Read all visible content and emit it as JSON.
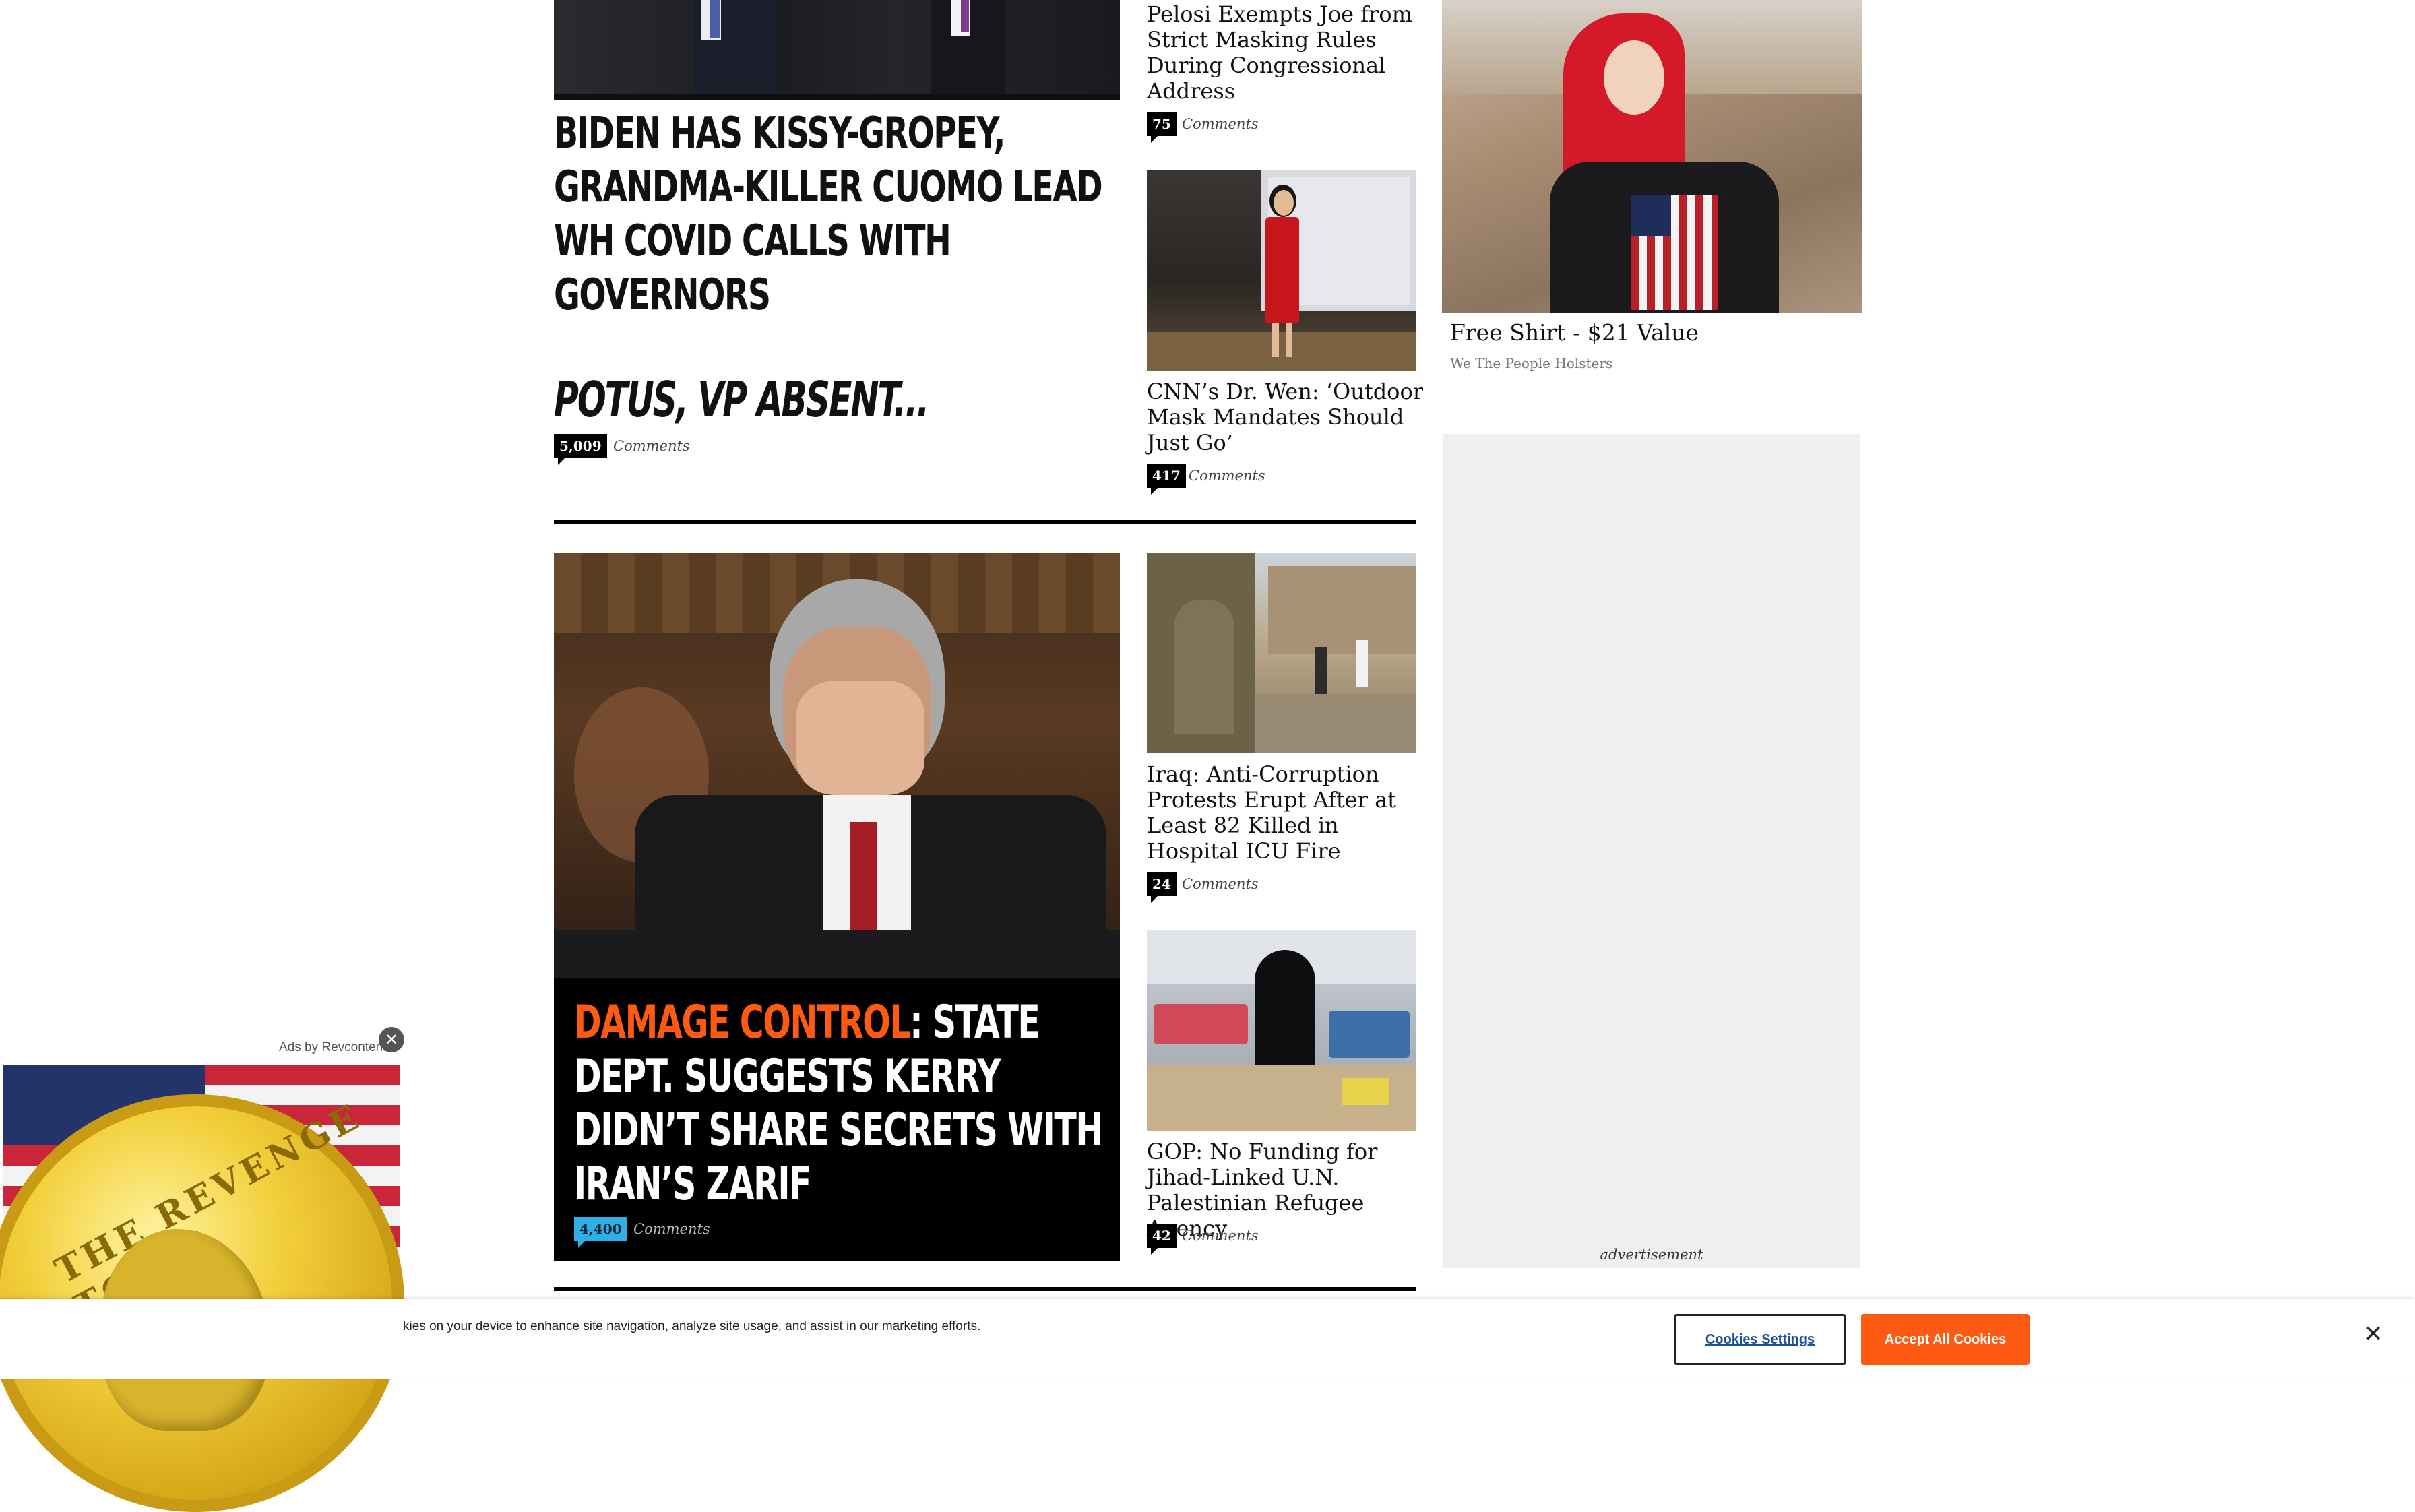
{
  "top_story": {
    "headline": "BIDEN HAS KISSY-GROPEY, GRANDMA-KILLER CUOMO LEAD WH COVID CALLS WITH GOVERNORS",
    "subhead": "POTUS, VP ABSENT...",
    "comment_count": "5,009",
    "comments_label": "Comments"
  },
  "side_stories_top": [
    {
      "title": "Pelosi Exempts Joe from Strict Masking Rules During Congressional Address",
      "comment_count": "75",
      "comments_label": "Comments"
    },
    {
      "title": "CNN’s Dr. Wen: ‘Outdoor Mask Mandates Should Just Go’",
      "comment_count": "417",
      "comments_label": "Comments"
    }
  ],
  "feature_story": {
    "headline_highlight": "DAMAGE CONTROL",
    "headline_rest": ": STATE DEPT. SUGGESTS KERRY DIDN’T SHARE SECRETS WITH IRAN’S ZARIF",
    "comment_count": "4,400",
    "comments_label": "Comments"
  },
  "side_stories_bottom": [
    {
      "title": "Iraq: Anti-Corruption Protests Erupt After at Least 82 Killed in Hospital ICU Fire",
      "comment_count": "24",
      "comments_label": "Comments"
    },
    {
      "title": "GOP: No Funding for Jihad-Linked U.N. Palestinian Refugee Agency",
      "comment_count": "42",
      "comments_label": "Comments"
    }
  ],
  "sidebar_ad": {
    "title": "Free Shirt - $21 Value",
    "sponsor": "We The People Holsters",
    "ad_label": "advertisement"
  },
  "floating_ad": {
    "label": "Ads by Revcontent",
    "coin_text": "THE REVENGE TOUR!"
  },
  "cookie_banner": {
    "text": "kies on your device to enhance site navigation, analyze site usage, and assist in our marketing efforts.",
    "settings_button": "Cookies Settings",
    "accept_button": "Accept All Cookies"
  },
  "colors": {
    "accent_orange": "#ff5a12",
    "comment_blue": "#2eb0e6",
    "cookie_accept": "#ff5a12"
  }
}
